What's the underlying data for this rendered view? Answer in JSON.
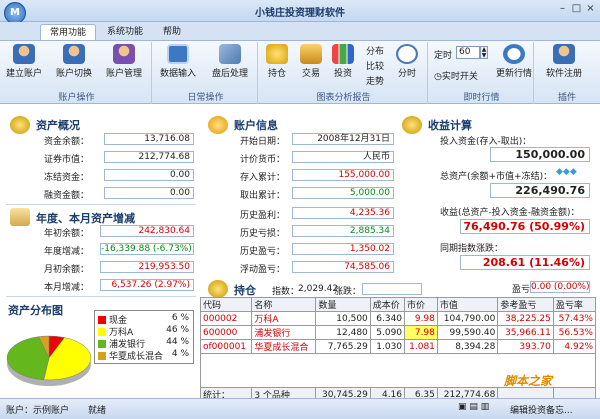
{
  "window": {
    "title": "小钱庄投资理财软件",
    "logo": "M"
  },
  "tabs": [
    "常用功能",
    "系统功能",
    "帮助"
  ],
  "ribbon": {
    "account": {
      "label": "账户操作",
      "buttons": [
        "建立账户",
        "账户切换",
        "账户管理"
      ]
    },
    "daily": {
      "label": "日常操作",
      "buttons": [
        "数据输入",
        "盘后处理"
      ]
    },
    "chart": {
      "label": "图表分析报告",
      "buttons": [
        "持仓",
        "交易",
        "投资"
      ],
      "small": [
        "分布",
        "比较",
        "走势"
      ],
      "minute": "分时"
    },
    "live": {
      "label": "即时行情",
      "timer_label": "定时",
      "timer_value": "60",
      "switch": "实时开关",
      "update": "更新行情"
    },
    "ext": {
      "label": "插件",
      "button": "软件注册"
    }
  },
  "asset_overview": {
    "title": "资产概况",
    "rows": [
      {
        "label": "资金余额：",
        "value": "13,716.08"
      },
      {
        "label": "证券市值：",
        "value": "212,774.68"
      },
      {
        "label": "冻结资金：",
        "value": "0.00"
      },
      {
        "label": "融资金额：",
        "value": "0.00"
      }
    ]
  },
  "growth": {
    "title": "年度、本月资产增减",
    "rows": [
      {
        "label": "年初余额：",
        "value": "242,830.64"
      },
      {
        "label": "年度增减：",
        "value": "-16,339.88 (-6.73%)"
      },
      {
        "label": "月初余额：",
        "value": "219,953.50"
      },
      {
        "label": "本月增减：",
        "value": "6,537.26 (2.97%)"
      }
    ]
  },
  "account_info": {
    "title": "账户信息",
    "rows": [
      {
        "label": "开始日期：",
        "value": "2008年12月31日"
      },
      {
        "label": "计价货币：",
        "value": "人民币"
      },
      {
        "label": "存入累计：",
        "value": "155,000.00"
      },
      {
        "label": "取出累计：",
        "value": "5,000.00"
      },
      {
        "label": "历史盈利：",
        "value": "4,235.36"
      },
      {
        "label": "历史亏损：",
        "value": "2,885.34"
      },
      {
        "label": "历史盈亏：",
        "value": "1,350.02"
      },
      {
        "label": "浮动盈亏：",
        "value": "74,585.06"
      }
    ]
  },
  "income": {
    "title": "收益计算",
    "invest_label": "投入资金(存入-取出)：",
    "invest_value": "150,000.00",
    "total_label": "总资产(余额+市值+冻结)：",
    "total_value": "226,490.76",
    "gain_label": "收益(总资产-投入资金-融资金额)：",
    "gain_value": "76,490.76 (50.99%)",
    "index_label": "同期指数涨跌：",
    "index_value": "208.61 (11.46%)",
    "pnl_label": "盈亏：",
    "pnl_value": "0.00 (0.00%)"
  },
  "holdings": {
    "title": "持仓",
    "index_label": "指数：",
    "index_value": "2,029.42",
    "change_label": "涨跌：",
    "columns": [
      "代码",
      "名称",
      "数量",
      "成本价",
      "市价",
      "市值",
      "参考盈亏",
      "盈亏率"
    ],
    "rows": [
      {
        "code": "000002",
        "name": "万科A",
        "qty": "10,500",
        "cost": "6.340",
        "price": "9.98",
        "value": "104,790.00",
        "pnl": "38,225.25",
        "rate": "57.43%"
      },
      {
        "code": "600000",
        "name": "浦发银行",
        "qty": "12,480",
        "cost": "5.090",
        "price": "7.98",
        "value": "99,590.40",
        "pnl": "35,966.11",
        "rate": "56.53%"
      },
      {
        "code": "of000001",
        "name": "华夏成长混合",
        "qty": "7,765.29",
        "cost": "1.030",
        "price": "1.081",
        "value": "8,394.28",
        "pnl": "393.70",
        "rate": "4.92%"
      }
    ],
    "footer": {
      "label": "统计：",
      "kinds": "3 个品种",
      "qty": "30,745.29",
      "cost": "4.16",
      "price": "6.35",
      "value": "212,774.68",
      "pnl": "",
      "rate": ""
    }
  },
  "distribution": {
    "title": "资产分布图",
    "items": [
      {
        "name": "现金",
        "pct": "6 %",
        "color": "#f00000"
      },
      {
        "name": "万科A",
        "pct": "46 %",
        "color": "#ffff00"
      },
      {
        "name": "浦发银行",
        "pct": "44 %",
        "color": "#64b81e"
      },
      {
        "name": "华夏成长混合",
        "pct": "4 %",
        "color": "#d8a020"
      }
    ]
  },
  "status": {
    "account": "账户：示例账户",
    "ready": "就绪",
    "right": "编辑投资备忘..."
  },
  "watermark": "脚本之家"
}
